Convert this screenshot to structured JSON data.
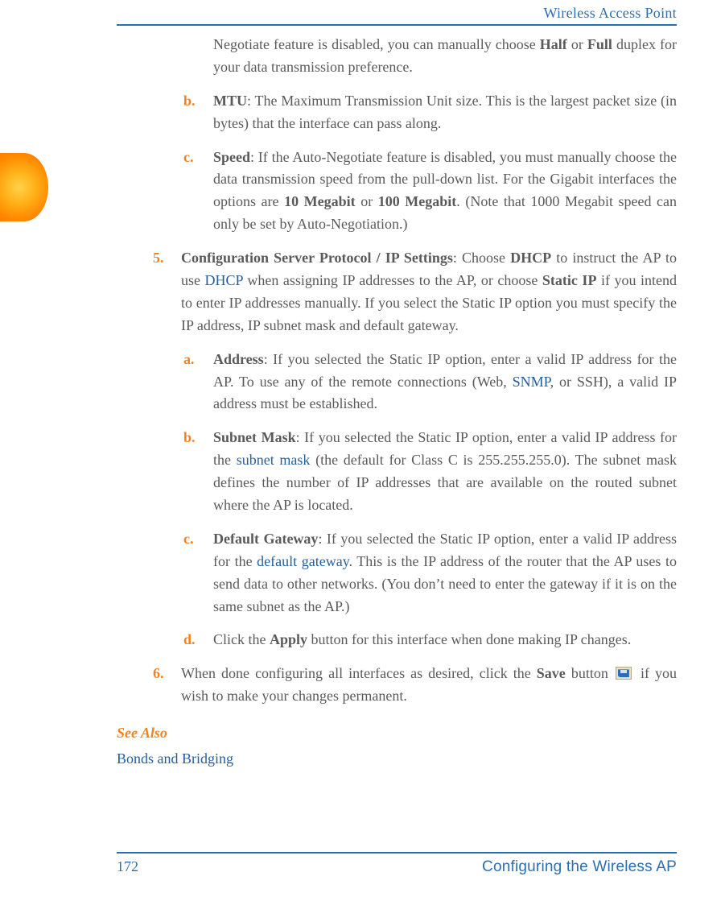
{
  "header": {
    "product": "Wireless Access Point"
  },
  "intro": {
    "cont_a": "Negotiate feature is disabled, you can manually choose ",
    "half": "Half",
    "mid": " or ",
    "full": "Full",
    "cont_b": " duplex for your data transmission preference."
  },
  "item_b": {
    "marker": "b.",
    "term": "MTU",
    "text": ": The Maximum Transmission Unit size. This is the largest packet size (in bytes) that the interface can pass along."
  },
  "item_c": {
    "marker": "c.",
    "term": "Speed",
    "t1": ": If the Auto-Negotiate feature is disabled, you must manually choose the data transmission speed from the pull-down list. For the Gigabit interfaces the options are ",
    "opt1": "10 Megabit",
    "or": " or ",
    "opt2": "100 Megabit",
    "t2": ". (Note that 1000 Megabit speed can only be set by Auto-Negotiation.)"
  },
  "step5": {
    "marker": "5.",
    "term": "Configuration Server Protocol / IP Settings",
    "t1": ": Choose ",
    "dhcp_b": "DHCP",
    "t2": " to instruct the AP to use ",
    "dhcp_l": "DHCP",
    "t3": " when assigning IP addresses to the AP, or choose ",
    "static": "Static IP",
    "t4": " if you intend to enter IP addresses manually. If you select the Static IP option you must specify the IP address, IP subnet mask and default gateway."
  },
  "s5a": {
    "marker": "a.",
    "term": "Address",
    "t1": ": If you selected the Static IP option, enter a valid IP address for the AP. To use any of the remote connections (Web, ",
    "snmp": "SNMP",
    "t2": ", or SSH), a valid IP address must be established."
  },
  "s5b": {
    "marker": "b.",
    "term": "Subnet Mask",
    "t1": ": If you selected the Static IP option, enter a valid IP address for the ",
    "link": "subnet mask",
    "t2": " (the default for Class C is 255.255.255.0). The subnet mask defines the number of IP addresses that are available on the routed subnet where the AP is located."
  },
  "s5c": {
    "marker": "c.",
    "term": "Default Gateway",
    "t1": ": If you selected the Static IP option, enter a valid IP address for the ",
    "link": "default gateway",
    "t2": ". This is the IP address of the router that the AP uses to send data to other networks. (You don’t need to enter the gateway if it is on the same subnet as the AP.)"
  },
  "s5d": {
    "marker": "d.",
    "t1": "Click the ",
    "apply": "Apply",
    "t2": " button for this interface when done making IP changes."
  },
  "step6": {
    "marker": "6.",
    "t1": "When done configuring all interfaces as desired, click the ",
    "save": "Save",
    "t2": " button ",
    "t3": " if you wish to make your changes permanent."
  },
  "see_also": {
    "heading": "See Also",
    "link": "Bonds and Bridging"
  },
  "footer": {
    "page": "172",
    "section": "Configuring the Wireless AP"
  }
}
